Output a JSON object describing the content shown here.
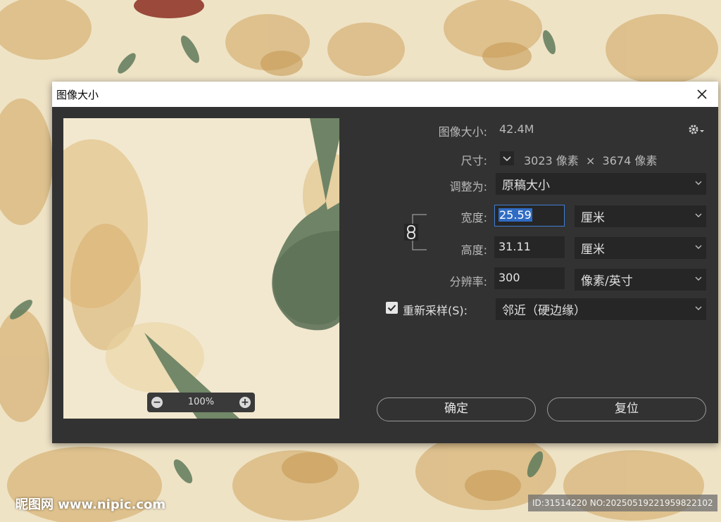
{
  "dialog": {
    "title": "图像大小",
    "image_size_label": "图像大小:",
    "image_size_value": "42.4M",
    "dimensions_label": "尺寸:",
    "dimensions_value": "3023 像素  ×  3674 像素",
    "fit_to_label": "调整为:",
    "fit_to_value": "原稿大小",
    "width_label": "宽度:",
    "width_value": "25.59",
    "width_unit": "厘米",
    "height_label": "高度:",
    "height_value": "31.11",
    "height_unit": "厘米",
    "resolution_label": "分辨率:",
    "resolution_value": "300",
    "resolution_unit": "像素/英寸",
    "resample_label": "重新采样(S):",
    "resample_checked": true,
    "resample_value": "邻近（硬边缘）",
    "zoom_value": "100%",
    "ok_label": "确定",
    "reset_label": "复位"
  },
  "watermark": {
    "site": "昵图网 www.nipic.com",
    "id_text": "ID:31514220 NO:20250519221959822102"
  },
  "colors": {
    "dialog_bg": "#323232",
    "field_bg": "#262626",
    "focus": "#3f7ed6",
    "text": "#b9b9b9"
  }
}
